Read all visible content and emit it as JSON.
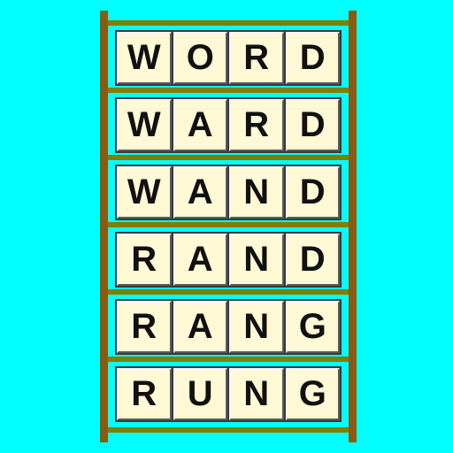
{
  "game": {
    "type": "word-ladder",
    "colors": {
      "background": "#00ffff",
      "frame": "#8a5a0f",
      "rail": "#7f7f00",
      "tile": "#fff9d6"
    },
    "words": [
      [
        "W",
        "O",
        "R",
        "D"
      ],
      [
        "W",
        "A",
        "R",
        "D"
      ],
      [
        "W",
        "A",
        "N",
        "D"
      ],
      [
        "R",
        "A",
        "N",
        "D"
      ],
      [
        "R",
        "A",
        "N",
        "G"
      ],
      [
        "R",
        "U",
        "N",
        "G"
      ]
    ]
  }
}
